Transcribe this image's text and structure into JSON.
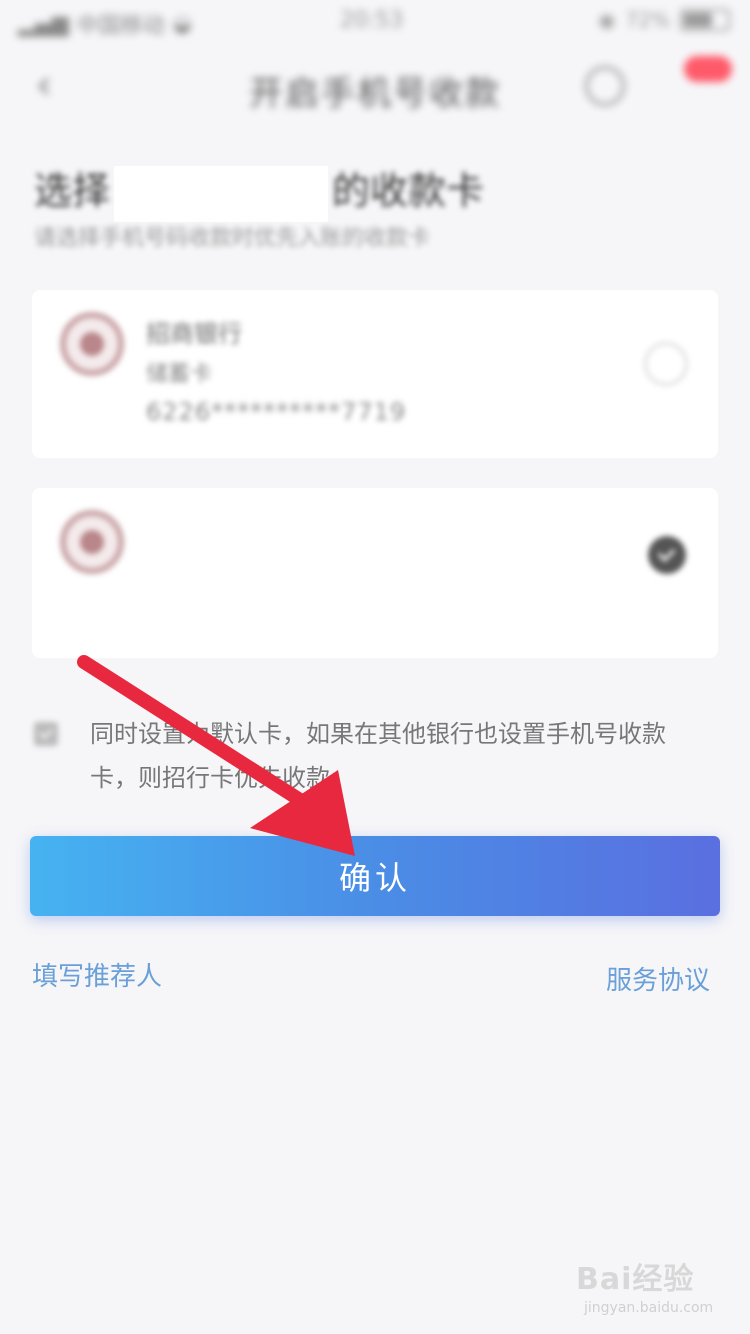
{
  "status_bar": {
    "carrier": "中国移动",
    "time": "20:53",
    "battery": "72%"
  },
  "nav": {
    "title": "开启手机号收款"
  },
  "header": {
    "title_prefix": "选择",
    "title_suffix": "的收款卡",
    "subtitle": "请选择手机号码收款时优先入账的收款卡"
  },
  "cards": [
    {
      "bank_name": "招商银行",
      "card_type": "储蓄卡",
      "card_number": "6226**********7719",
      "selected": false
    },
    {
      "selected": true
    }
  ],
  "agreement": {
    "text": "同时设置为默认卡，如果在其他银行也设置手机号收款卡，则招行卡优先收款",
    "checked": true
  },
  "confirm_button": {
    "label": "确认"
  },
  "links": {
    "referrer": "填写推荐人",
    "service_agreement": "服务协议"
  },
  "watermark": {
    "logo": "Bai经验",
    "url": "jingyan.baidu.com"
  },
  "colors": {
    "button_start": "#46b3f1",
    "button_end": "#5a6fe0",
    "link": "#6a9fd8",
    "arrow": "#e8283f"
  }
}
